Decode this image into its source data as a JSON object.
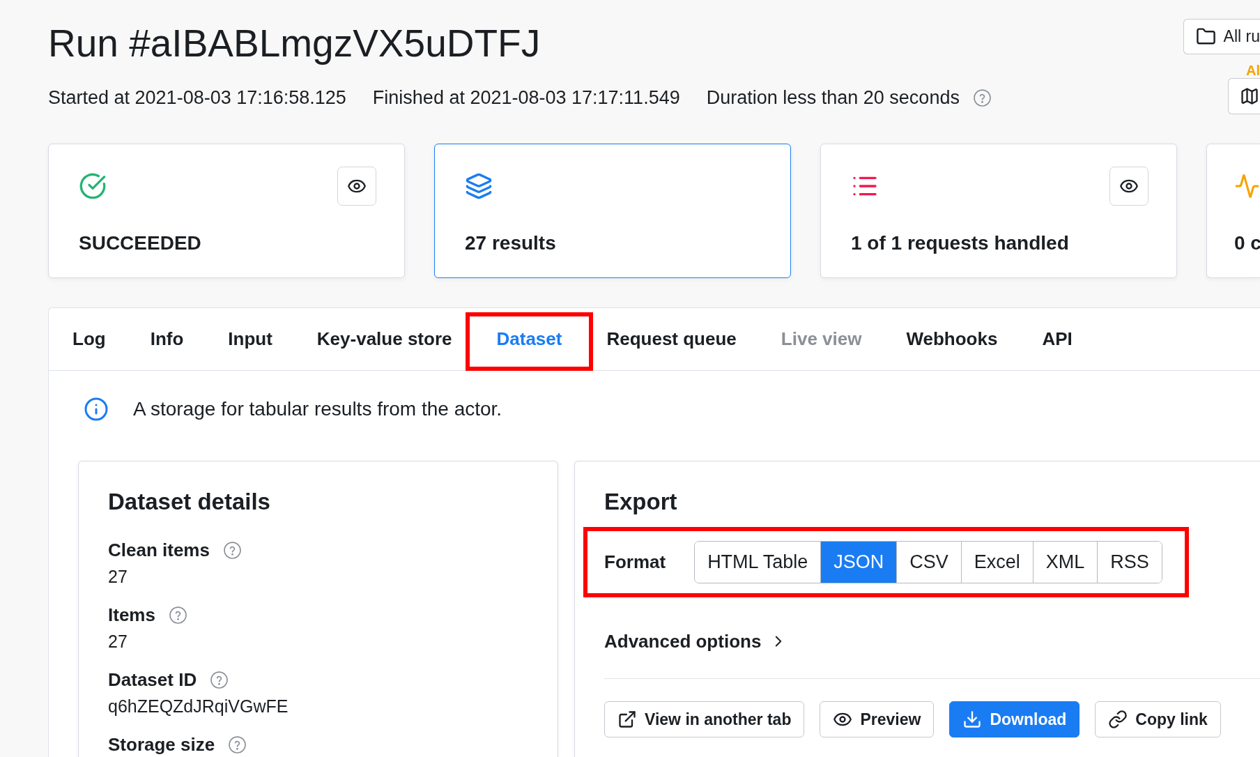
{
  "header": {
    "title": "Run #aIBABLmgzVX5uDTFJ",
    "meta": [
      {
        "text": "Started at 2021-08-03 17:16:58.125",
        "help": false
      },
      {
        "text": "Finished at 2021-08-03 17:17:11.549",
        "help": false
      },
      {
        "text": "Duration less than 20 seconds",
        "help": true
      }
    ]
  },
  "header_actions": {
    "all_runs_button": "All ru",
    "status_label": "Al"
  },
  "stat_cards": [
    {
      "kind": "status",
      "label": "SUCCEEDED",
      "selected": false,
      "preview_button": true
    },
    {
      "kind": "results",
      "label": "27 results",
      "selected": true,
      "preview_button": false
    },
    {
      "kind": "requests",
      "label": "1 of 1 requests handled",
      "selected": false,
      "preview_button": true
    },
    {
      "kind": "activity",
      "label": "0 c",
      "selected": false,
      "preview_button": false
    }
  ],
  "tabs": [
    {
      "label": "Log",
      "selected": false,
      "disabled": false,
      "highlighted": false
    },
    {
      "label": "Info",
      "selected": false,
      "disabled": false,
      "highlighted": false
    },
    {
      "label": "Input",
      "selected": false,
      "disabled": false,
      "highlighted": false
    },
    {
      "label": "Key-value store",
      "selected": false,
      "disabled": false,
      "highlighted": false
    },
    {
      "label": "Dataset",
      "selected": true,
      "disabled": false,
      "highlighted": true
    },
    {
      "label": "Request queue",
      "selected": false,
      "disabled": false,
      "highlighted": false
    },
    {
      "label": "Live view",
      "selected": false,
      "disabled": true,
      "highlighted": false
    },
    {
      "label": "Webhooks",
      "selected": false,
      "disabled": false,
      "highlighted": false
    },
    {
      "label": "API",
      "selected": false,
      "disabled": false,
      "highlighted": false
    }
  ],
  "info_text": "A storage for tabular results from the actor.",
  "dataset_details": {
    "title": "Dataset details",
    "fields": [
      {
        "label": "Clean items",
        "value": "27",
        "help": true
      },
      {
        "label": "Items",
        "value": "27",
        "help": true
      },
      {
        "label": "Dataset ID",
        "value": "q6hZEQZdJRqiVGwFE",
        "help": true
      },
      {
        "label": "Storage size",
        "help": true
      }
    ]
  },
  "export": {
    "title": "Export",
    "format_label": "Format",
    "highlighted": true,
    "formats": [
      {
        "label": "HTML Table",
        "selected": false
      },
      {
        "label": "JSON",
        "selected": true
      },
      {
        "label": "CSV",
        "selected": false
      },
      {
        "label": "Excel",
        "selected": false
      },
      {
        "label": "XML",
        "selected": false
      },
      {
        "label": "RSS",
        "selected": false
      }
    ],
    "advanced_options": "Advanced options",
    "buttons": [
      {
        "kind": "open",
        "label": "View in another tab",
        "primary": false
      },
      {
        "kind": "preview",
        "label": "Preview",
        "primary": false
      },
      {
        "kind": "download",
        "label": "Download",
        "primary": true
      },
      {
        "kind": "copy",
        "label": "Copy link",
        "primary": false
      }
    ]
  }
}
